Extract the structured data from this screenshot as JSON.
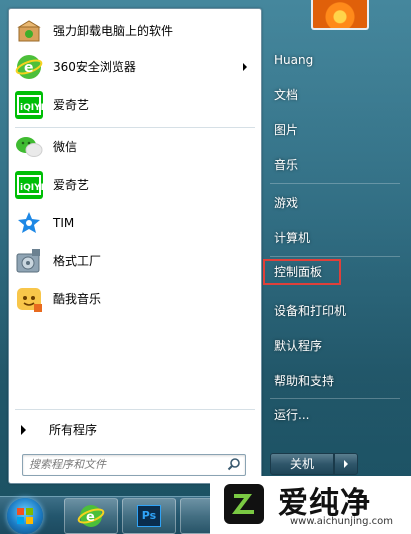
{
  "start_menu": {
    "programs": [
      {
        "label": "强力卸载电脑上的软件",
        "icon": "uninstall-box-icon"
      },
      {
        "label": "360安全浏览器",
        "icon": "360-browser-icon",
        "has_submenu": true
      },
      {
        "label": "爱奇艺",
        "icon": "iqiyi-icon"
      },
      {
        "label": "微信",
        "icon": "wechat-icon"
      },
      {
        "label": "爱奇艺",
        "icon": "iqiyi-icon"
      },
      {
        "label": "TIM",
        "icon": "tim-icon"
      },
      {
        "label": "格式工厂",
        "icon": "format-factory-icon"
      },
      {
        "label": "酷我音乐",
        "icon": "kuwo-music-icon"
      }
    ],
    "all_programs_label": "所有程序",
    "search": {
      "placeholder": "搜索程序和文件"
    }
  },
  "right_panel": {
    "items": [
      {
        "label": "Huang"
      },
      {
        "label": "文档"
      },
      {
        "label": "图片"
      },
      {
        "label": "音乐"
      },
      {
        "label": "游戏"
      },
      {
        "label": "计算机"
      },
      {
        "label": "控制面板",
        "highlighted": true
      },
      {
        "label": "设备和打印机"
      },
      {
        "label": "默认程序"
      },
      {
        "label": "帮助和支持"
      },
      {
        "label": "运行..."
      }
    ],
    "shutdown_label": "关机"
  },
  "taskbar": {
    "apps": [
      {
        "icon": "360-browser-icon"
      },
      {
        "icon": "photoshop-icon",
        "text": "Ps"
      }
    ]
  },
  "watermark": {
    "brand": "爱纯净",
    "url": "www.aichunjing.com"
  },
  "colors": {
    "highlight_border": "#e0403a",
    "iqiyi_green": "#00be06",
    "accent_blue": "#1b7bc4"
  }
}
